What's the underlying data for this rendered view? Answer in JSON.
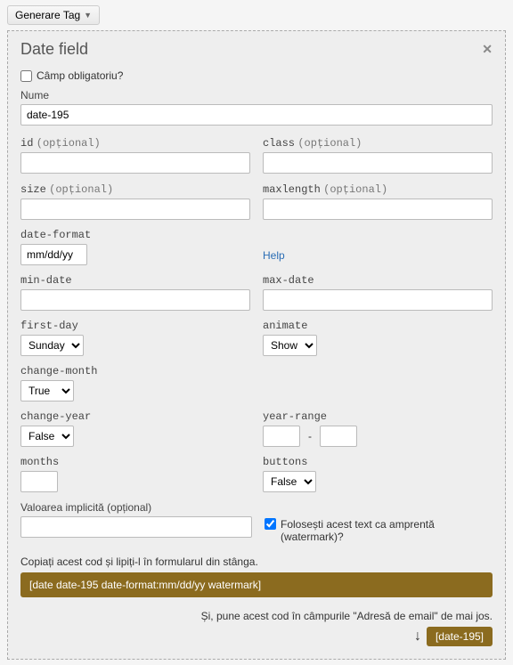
{
  "topButton": "Generare Tag",
  "panel": {
    "title": "Date field"
  },
  "requiredLabel": "Câmp obligatoriu?",
  "nameLabel": "Nume",
  "nameValue": "date-195",
  "optText": "(opțional)",
  "labels": {
    "id": "id",
    "class": "class",
    "size": "size",
    "maxlength": "maxlength",
    "dateFormat": "date-format",
    "minDate": "min-date",
    "maxDate": "max-date",
    "firstDay": "first-day",
    "animate": "animate",
    "changeMonth": "change-month",
    "changeYear": "change-year",
    "yearRange": "year-range",
    "months": "months",
    "buttons": "buttons"
  },
  "dateFormatValue": "mm/dd/yy",
  "helpText": "Help",
  "selects": {
    "firstDay": "Sunday",
    "animate": "Show",
    "changeMonth": "True",
    "changeYear": "False",
    "buttons": "False"
  },
  "defaultLabel": "Valoarea implicită (opțional)",
  "watermarkLabel": "Folosești acest text ca amprentă (watermark)?",
  "copyLabel": "Copiați acest cod și lipiți-l în formularul din stânga.",
  "codeBox": "[date date-195 date-format:mm/dd/yy watermark]",
  "emailText": "Și, pune acest cod în câmpurile \"Adresă de email\" de mai jos.",
  "emailCode": "[date-195]",
  "rangeSep": "-"
}
